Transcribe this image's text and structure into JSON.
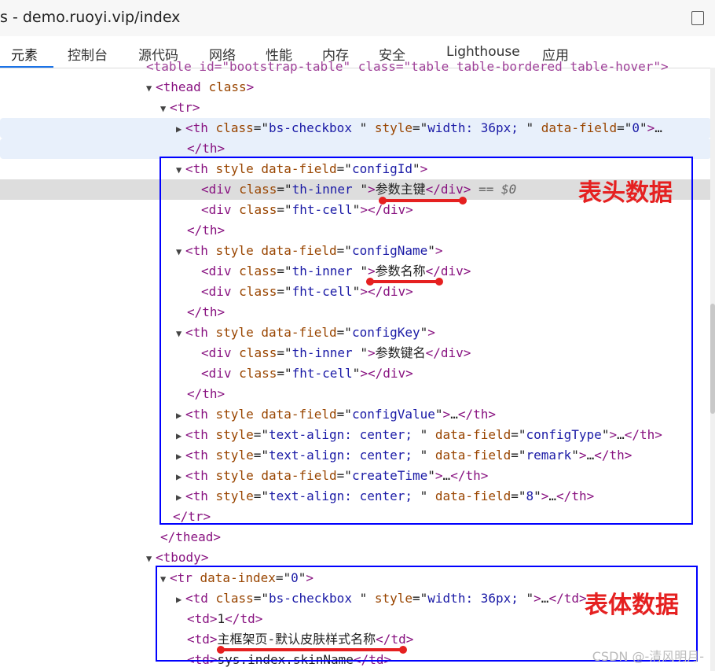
{
  "window": {
    "title": "s - demo.ruoyi.vip/index"
  },
  "tabs": [
    "元素",
    "控制台",
    "源代码",
    "网络",
    "性能",
    "内存",
    "安全",
    "Lighthouse",
    "应用"
  ],
  "dom": {
    "partial_line": "<table id=\"bootstrap-table\" class=\"table table-bordered table-hover\">",
    "thead_open": "thead",
    "thead_attr": "class",
    "tr_open": "tr",
    "row1_tag": "th",
    "row1_class_attr": "class",
    "row1_class_val": "bs-checkbox ",
    "row1_style_attr": "style",
    "row1_style_val": "width: 36px; ",
    "row1_field_attr": "data-field",
    "row1_field_val": "0",
    "ellipsis": "…",
    "th_close": "</th>",
    "th_style": "style",
    "data_field": "data-field",
    "div_tag": "div",
    "class_attr": "class",
    "th_inner": "th-inner ",
    "fht_cell": "fht-cell",
    "div_close": "</div>",
    "configId": "configId",
    "label_configId": "参数主键",
    "dollar0": "== $0",
    "configName": "configName",
    "label_configName": "参数名称",
    "configKey": "configKey",
    "label_configKey": "参数键名",
    "configValue": "configValue",
    "text_align_center": "text-align: center; ",
    "configType": "configType",
    "remark": "remark",
    "createTime": "createTime",
    "field8": "8",
    "tr_close": "</tr>",
    "thead_close": "</thead>",
    "tbody_open": "tbody",
    "tr_data_index_attr": "data-index",
    "tr_data_index_val": "0",
    "td_tag": "td",
    "td_close": "</td>",
    "td1": "1",
    "td2": "主框架页-默认皮肤样式名称",
    "td3": "sys.index.skinName"
  },
  "annotations": {
    "header_label": "表头数据",
    "body_label": "表体数据"
  },
  "watermark": "CSDN @-清风明月-"
}
